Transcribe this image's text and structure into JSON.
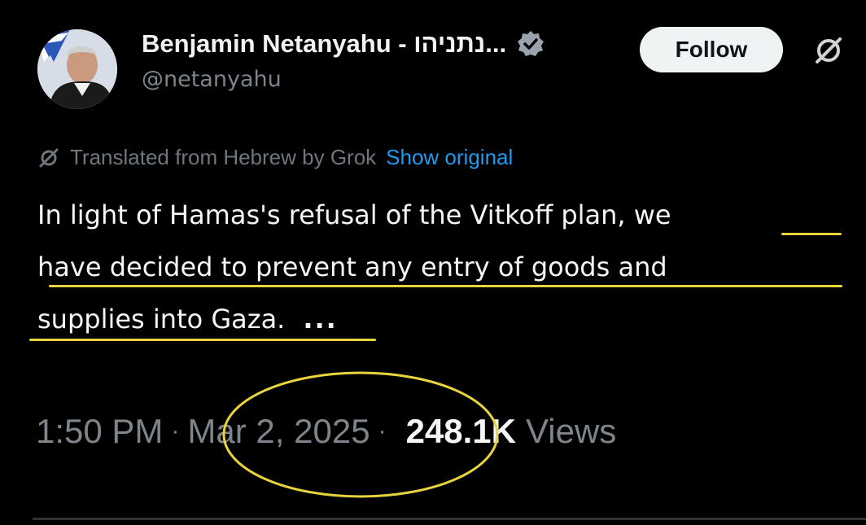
{
  "author": {
    "display_name": "Benjamin Netanyahu - נתניהו...",
    "handle": "@netanyahu",
    "verified_icon": "verified-badge-icon"
  },
  "actions": {
    "follow_label": "Follow",
    "grok_icon": "grok-icon"
  },
  "translation": {
    "label": "Translated from Hebrew by Grok",
    "show_original": "Show original"
  },
  "tweet": {
    "lines": [
      "In light of Hamas's refusal of the Vitkoff plan, we",
      "have decided to prevent any entry of goods and",
      "supplies into Gaza."
    ],
    "more": "..."
  },
  "meta": {
    "time": "1:50 PM",
    "separator": "·",
    "date": "Mar 2, 2025",
    "views_count": "248.1K",
    "views_label": "Views"
  },
  "colors": {
    "background": "#000000",
    "highlight": "#e8d33d",
    "link": "#1d9bf0",
    "muted": "#7d848a"
  }
}
